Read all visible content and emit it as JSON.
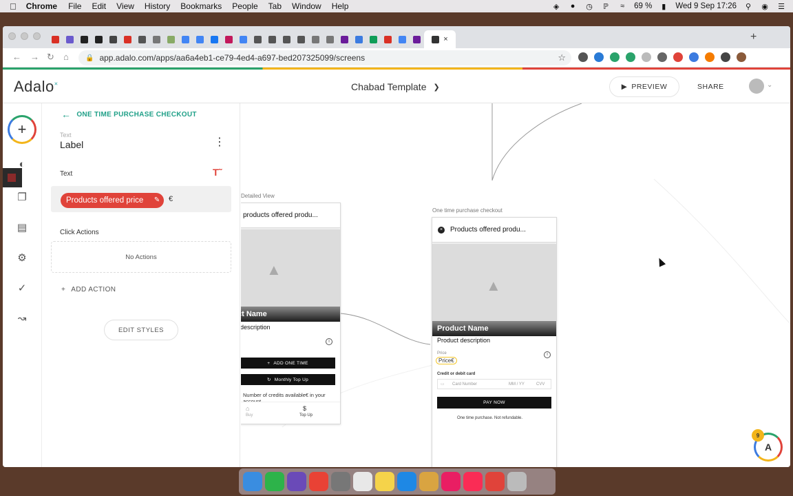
{
  "menubar": {
    "app": "Chrome",
    "items": [
      "File",
      "Edit",
      "View",
      "History",
      "Bookmarks",
      "People",
      "Tab",
      "Window",
      "Help"
    ],
    "battery": "69 %",
    "clock": "Wed 9 Sep  17:26"
  },
  "browser": {
    "url": "app.adalo.com/apps/aa6a4eb1-ce79-4ed4-a697-bed207325099/screens",
    "tab_favicon_colors": [
      "#d93025",
      "#6a5acd",
      "#222",
      "#222",
      "#444",
      "#d93025",
      "#555",
      "#777",
      "#8a6",
      "#4285f4",
      "#4285f4",
      "#1877f2",
      "#c2185b",
      "#4285f4",
      "#555",
      "#555",
      "#555",
      "#555",
      "#777",
      "#777",
      "#6a1b9a",
      "#3c7be0",
      "#0f9d58",
      "#d93025",
      "#4285f4",
      "#6a1b9a"
    ],
    "extension_colors": [
      "#555",
      "#2a7bd6",
      "#2aa36b",
      "#2aa36b",
      "#bbb",
      "#666",
      "#e0433a",
      "#3c7be0",
      "#f57c00",
      "#444",
      "#8a5a3a"
    ]
  },
  "header": {
    "logo": "Adalo",
    "project_title": "Chabad Template",
    "preview_label": "PREVIEW",
    "share_label": "SHARE"
  },
  "panel": {
    "back_label": "ONE TIME PURCHASE CHECKOUT",
    "component_kind": "Text",
    "component_name": "Label",
    "text_section": "Text",
    "text_chip": "Products offered price",
    "text_suffix": "€",
    "click_actions_label": "Click Actions",
    "no_actions": "No Actions",
    "add_action": "ADD ACTION",
    "edit_styles": "EDIT STYLES"
  },
  "canvas": {
    "detail_screen": {
      "label": "Detailed View",
      "title": "products offered produ...",
      "product_name": "ct Name",
      "description": "description",
      "btn_one_time": "ADD ONE TIME",
      "btn_monthly": "Monthly Top Up",
      "credits_text": "Number of credits available€ in your account",
      "nav_buy": "Buy",
      "nav_topup": "Top Up"
    },
    "checkout_screen": {
      "label": "One time purchase checkout",
      "title": "Products offered produ...",
      "product_name": "Product Name",
      "description": "Product description",
      "price_caption": "Price",
      "price_value": "Price€",
      "card_caption": "Credit or debit card",
      "card_number": "Card Number",
      "card_exp": "MM / YY",
      "card_cvv": "CVV",
      "pay_button": "PAY NOW",
      "footnote": "One time purchase. Not refundable."
    }
  },
  "help_badge": {
    "count": "9"
  },
  "dock_colors": [
    "#3a8de0",
    "#2db34a",
    "#6a4ab8",
    "#e94235",
    "#777",
    "#e8e8e8",
    "#f5d34a",
    "#1e88e5",
    "#d9a441",
    "#e91e63",
    "#fa2c55",
    "#e0433a",
    "#bbb"
  ]
}
